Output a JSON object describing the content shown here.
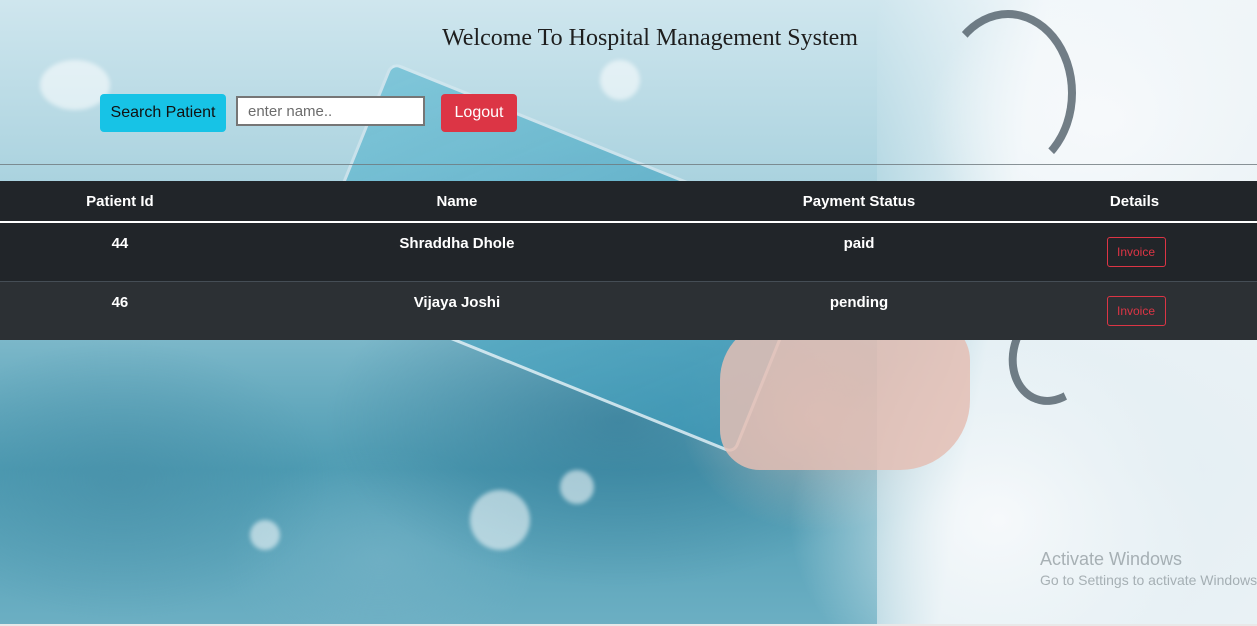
{
  "header": {
    "title": "Welcome To Hospital Management System"
  },
  "toolbar": {
    "search_label": "Search Patient",
    "search_placeholder": "enter name..",
    "search_value": "",
    "logout_label": "Logout"
  },
  "table": {
    "columns": [
      "Patient Id",
      "Name",
      "Payment Status",
      "Details"
    ],
    "rows": [
      {
        "id": "44",
        "name": "Shraddha Dhole",
        "status": "paid",
        "action": "Invoice"
      },
      {
        "id": "46",
        "name": "Vijaya Joshi",
        "status": "pending",
        "action": "Invoice"
      }
    ]
  },
  "watermark": {
    "title": "Activate Windows",
    "subtitle": "Go to Settings to activate Windows."
  },
  "colors": {
    "search_button": "#17c3e6",
    "logout_button": "#dc3545",
    "table_header": "#212529",
    "invoice_outline": "#dc3545"
  },
  "icons": []
}
